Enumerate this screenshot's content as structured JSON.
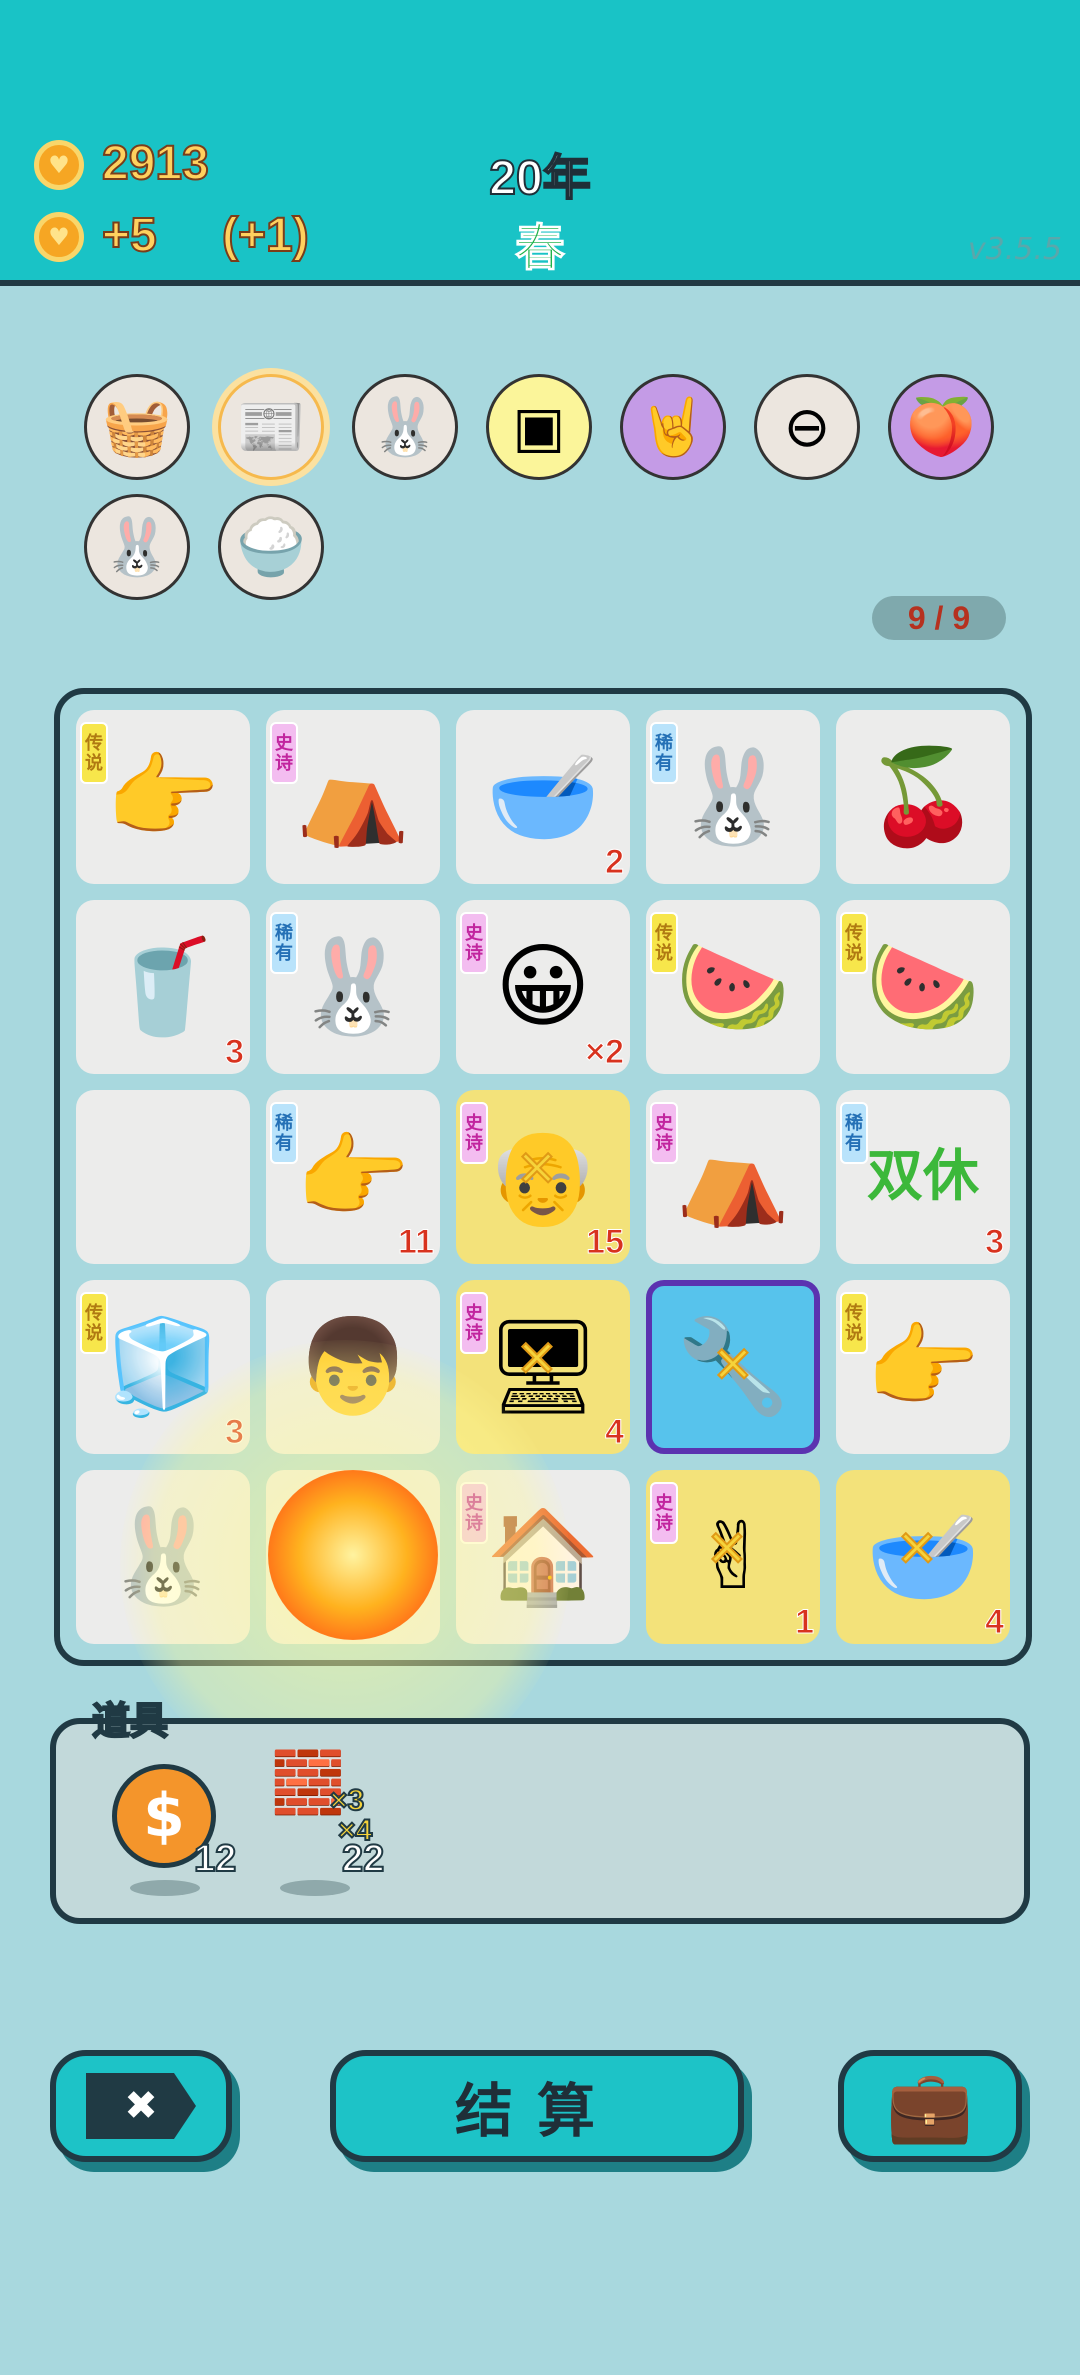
{
  "header": {
    "coins": "2913",
    "income": "+5",
    "bonus": "(+1)",
    "year": "20年",
    "season": "春",
    "version": "v3.5.5"
  },
  "relics": [
    {
      "icon": "fruit-basket-icon",
      "glyph": "🧺"
    },
    {
      "icon": "time-magazine-icon",
      "glyph": "📰"
    },
    {
      "icon": "bunny-icon",
      "glyph": "🐰"
    },
    {
      "icon": "cpu-chip-icon",
      "glyph": "▣"
    },
    {
      "icon": "rock-hand-icon",
      "glyph": "🤘"
    },
    {
      "icon": "minus-circle-icon",
      "glyph": "⊖"
    },
    {
      "icon": "eyepatch-peach-icon",
      "glyph": "🍑"
    },
    {
      "icon": "bunny-icon",
      "glyph": "🐰"
    },
    {
      "icon": "rice-bowl-icon",
      "glyph": "🍚"
    }
  ],
  "slot_counter": "9 / 9",
  "tags": {
    "legend": "传说",
    "epic": "史诗",
    "rare": "稀有"
  },
  "board": {
    "cells": [
      {
        "glyph": "👉",
        "icon": "pointing-hand-icon",
        "tag": "legend"
      },
      {
        "glyph": "⛺",
        "icon": "bunny-tent-icon",
        "tag": "epic"
      },
      {
        "glyph": "🥣",
        "icon": "soup-bowl-icon",
        "count": "2"
      },
      {
        "glyph": "🐰",
        "icon": "bunny-icon",
        "tag": "rare"
      },
      {
        "glyph": "🍒",
        "icon": "cherry-icon"
      },
      {
        "glyph": "🥤",
        "icon": "soda-cup-icon",
        "count": "3"
      },
      {
        "glyph": "🐰",
        "icon": "bunny-icon",
        "tag": "rare"
      },
      {
        "glyph": "😀",
        "icon": "6g-face-icon",
        "tag": "epic",
        "count": "×2"
      },
      {
        "glyph": "🍉",
        "icon": "watermelon-icon",
        "tag": "legend"
      },
      {
        "glyph": "🍉",
        "icon": "watermelon-icon",
        "tag": "legend"
      },
      {
        "glyph": "",
        "icon": "empty-slot"
      },
      {
        "glyph": "👉",
        "icon": "brown-hand-star-icon",
        "tag": "rare",
        "count": "11"
      },
      {
        "glyph": "👴",
        "icon": "old-man-face-icon",
        "tag": "epic",
        "count": "15",
        "hl": true
      },
      {
        "glyph": "⛺",
        "icon": "bunny-tent-icon",
        "tag": "epic"
      },
      {
        "glyph": "双休",
        "icon": "double-weekend-icon",
        "tag": "rare",
        "count": "3"
      },
      {
        "glyph": "🧊",
        "icon": "fridge-icon",
        "tag": "legend",
        "count": "3"
      },
      {
        "glyph": "👦",
        "icon": "boy-face-icon"
      },
      {
        "glyph": "🖥",
        "icon": "graphics-card-icon",
        "tag": "epic",
        "count": "4",
        "hl": true
      },
      {
        "glyph": "🔧",
        "icon": "selected-item-icon",
        "sel": true
      },
      {
        "glyph": "👉",
        "icon": "pointing-hand-icon",
        "tag": "legend"
      },
      {
        "glyph": "🐰",
        "icon": "bunny-icon"
      },
      {
        "glyph": "💥",
        "icon": "explosion-icon"
      },
      {
        "glyph": "🏠",
        "icon": "haunted-house-icon",
        "tag": "epic"
      },
      {
        "glyph": "✌",
        "icon": "gray-hand-icon",
        "tag": "epic",
        "count": "1",
        "hl": true
      },
      {
        "glyph": "🥣",
        "icon": "soup-bowl-icon",
        "count": "4",
        "hl": true
      }
    ]
  },
  "items_panel": {
    "title": "道具",
    "items": [
      {
        "icon": "dollar-coin-icon",
        "glyph": "$",
        "count": "12"
      },
      {
        "icon": "bricks-icon",
        "glyph": "🧱",
        "count": "22",
        "mult1": "×3",
        "mult2": "×4"
      }
    ]
  },
  "buttons": {
    "close_glyph": "✖",
    "settle_label": "结算",
    "briefcase_glyph": "💼"
  },
  "colors": {
    "header_bg": "#19c3c6",
    "page_bg": "#a8d8de",
    "accent_teal": "#1dc3c7",
    "legend_tag": "#f7e64b",
    "epic_tag": "#f3bdf0",
    "rare_tag": "#b9e3fb"
  }
}
